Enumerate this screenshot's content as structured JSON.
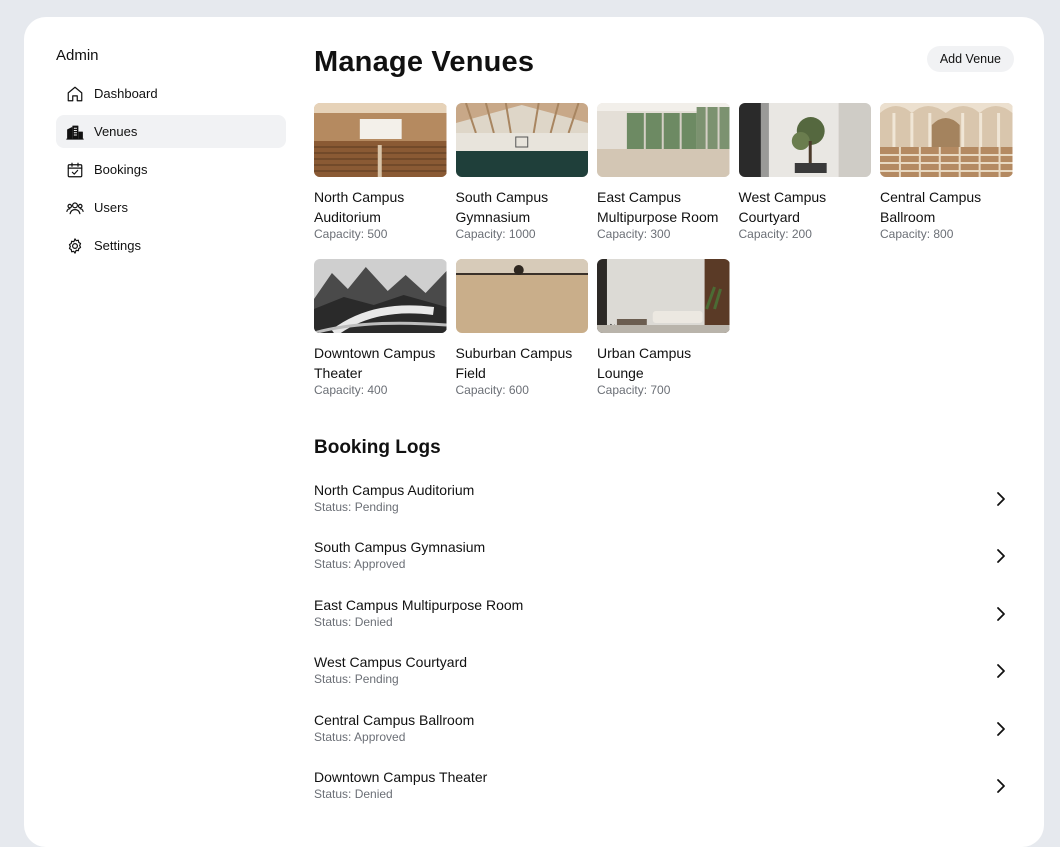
{
  "sidebar": {
    "brand": "Admin",
    "items": [
      {
        "label": "Dashboard",
        "icon": "home-icon",
        "active": false
      },
      {
        "label": "Venues",
        "icon": "building-icon",
        "active": true
      },
      {
        "label": "Bookings",
        "icon": "calendar-check-icon",
        "active": false
      },
      {
        "label": "Users",
        "icon": "users-icon",
        "active": false
      },
      {
        "label": "Settings",
        "icon": "gear-icon",
        "active": false
      }
    ]
  },
  "main": {
    "title": "Manage Venues",
    "add_button": "Add Venue",
    "venues": [
      {
        "name": "North Campus Auditorium",
        "capacity": "Capacity: 500",
        "image": "auditorium"
      },
      {
        "name": "South Campus Gymnasium",
        "capacity": "Capacity: 1000",
        "image": "gymnasium"
      },
      {
        "name": "East Campus Multipurpose Room",
        "capacity": "Capacity: 300",
        "image": "multipurpose-room"
      },
      {
        "name": "West Campus Courtyard",
        "capacity": "Capacity: 200",
        "image": "courtyard"
      },
      {
        "name": "Central Campus Ballroom",
        "capacity": "Capacity: 800",
        "image": "ballroom"
      },
      {
        "name": "Downtown Campus Theater",
        "capacity": "Capacity: 400",
        "image": "mountains"
      },
      {
        "name": "Suburban Campus Field",
        "capacity": "Capacity: 600",
        "image": "field"
      },
      {
        "name": "Urban Campus Lounge",
        "capacity": "Capacity: 700",
        "image": "lounge"
      }
    ],
    "booking_logs_title": "Booking Logs",
    "booking_logs": [
      {
        "name": "North Campus Auditorium",
        "status": "Status: Pending"
      },
      {
        "name": "South Campus Gymnasium",
        "status": "Status: Approved"
      },
      {
        "name": "East Campus Multipurpose Room",
        "status": "Status: Denied"
      },
      {
        "name": "West Campus Courtyard",
        "status": "Status: Pending"
      },
      {
        "name": "Central Campus Ballroom",
        "status": "Status: Approved"
      },
      {
        "name": "Downtown Campus Theater",
        "status": "Status: Denied"
      }
    ]
  }
}
